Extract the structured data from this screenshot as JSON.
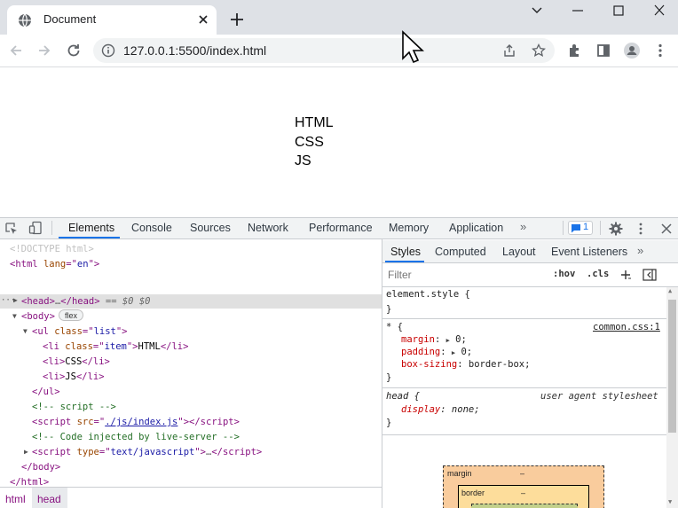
{
  "browser": {
    "tab_title": "Document",
    "url": "127.0.0.1:5500/index.html"
  },
  "page": {
    "list_items": [
      "HTML",
      "CSS",
      "JS"
    ]
  },
  "devtools": {
    "tabs": [
      "Elements",
      "Console",
      "Sources",
      "Network",
      "Performance",
      "Memory",
      "Application"
    ],
    "issues_count": "1",
    "elements": {
      "doctype": "<!DOCTYPE html>",
      "html_open": "html",
      "html_lang_attr": "lang",
      "html_lang_val": "en",
      "head_text": "head",
      "head_suffix": "== $0",
      "body_text": "body",
      "flex_badge": "flex",
      "ul_class": "list",
      "li_class": "item",
      "li1": "HTML",
      "li2": "CSS",
      "li3": "JS",
      "comment_script": "<!-- script -->",
      "script_src": "./js/index.js",
      "comment_live": "<!-- Code injected by live-server -->",
      "script_type": "text/javascript"
    },
    "breadcrumbs": [
      "html",
      "head"
    ],
    "styles": {
      "tabs": [
        "Styles",
        "Computed",
        "Layout",
        "Event Listeners"
      ],
      "filter_placeholder": "Filter",
      "hov": ":hov",
      "cls": ".cls",
      "element_style": "element.style {",
      "universal_selector": "* {",
      "universal_source": "common.css:1",
      "props": [
        {
          "name": "margin",
          "value": "0;"
        },
        {
          "name": "padding",
          "value": "0;"
        },
        {
          "name": "box-sizing",
          "value": "border-box;"
        }
      ],
      "head_selector": "head {",
      "head_source": "user agent stylesheet",
      "head_prop": "display",
      "head_val": "none;",
      "close_brace": "}",
      "boxmodel": {
        "margin_label": "margin",
        "margin_val": "–",
        "border_label": "border",
        "border_val": "–"
      }
    }
  }
}
